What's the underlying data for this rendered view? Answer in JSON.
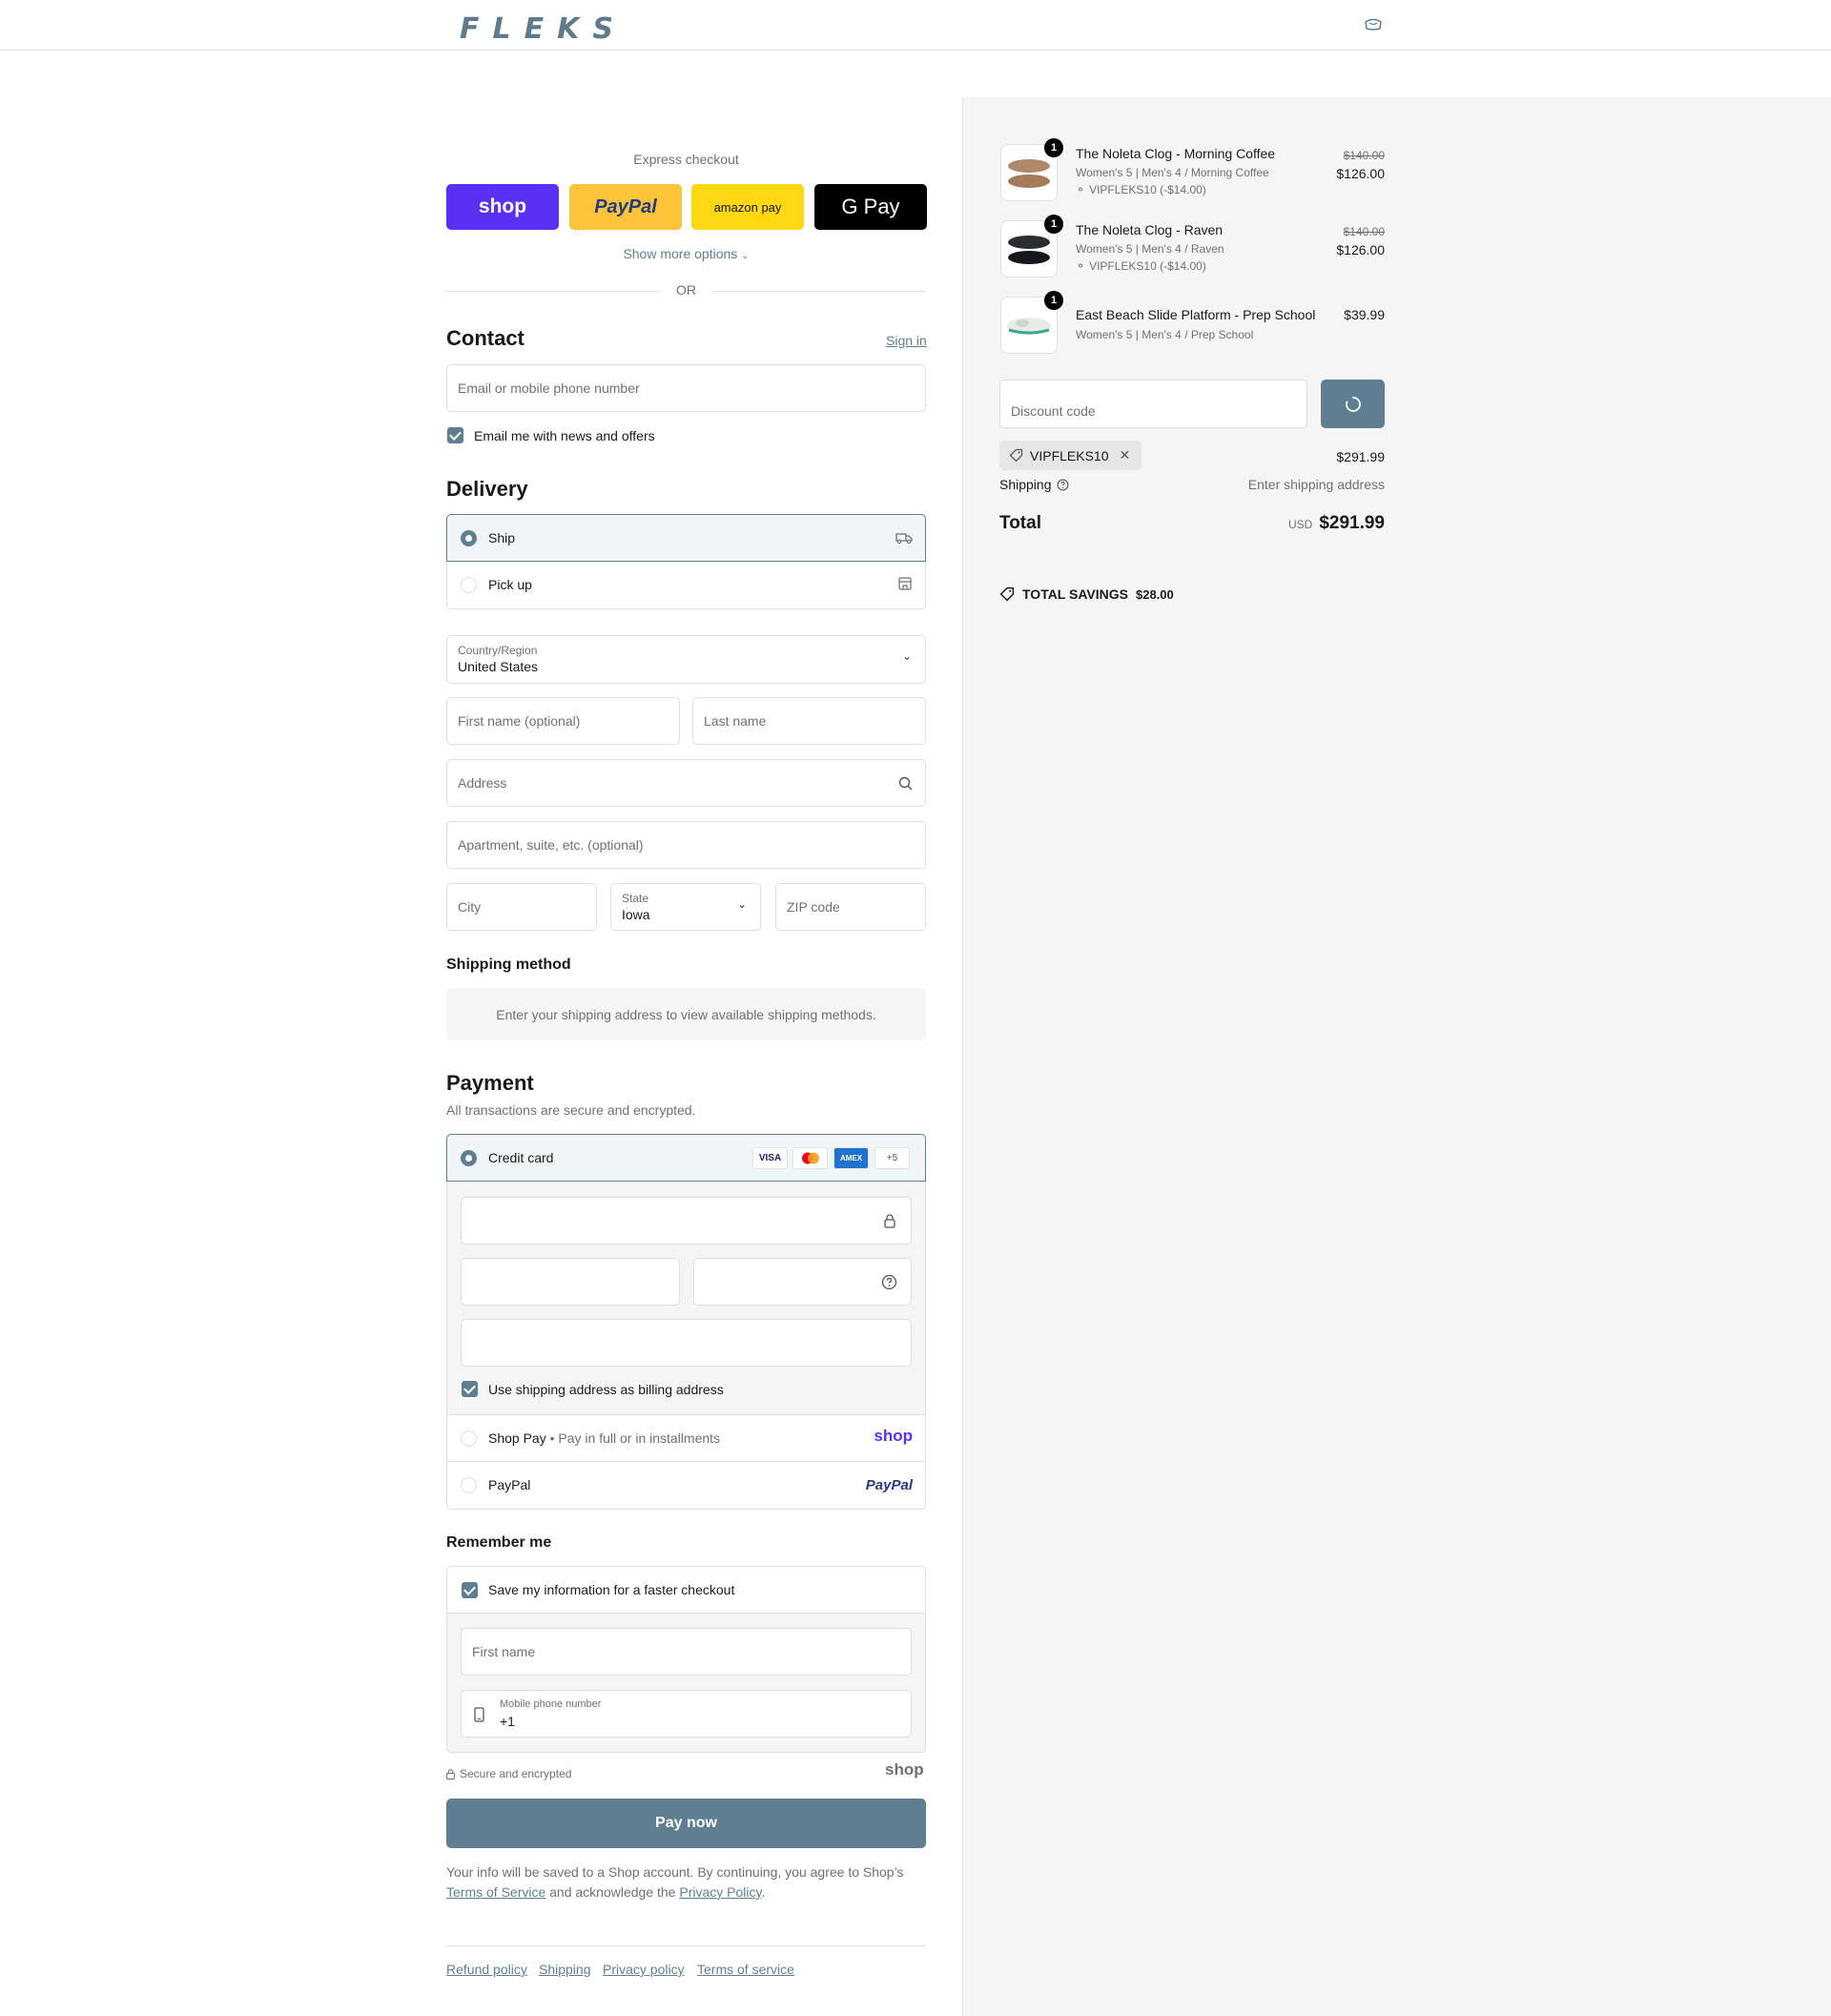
{
  "brand": {
    "logo_text": "FLEKS"
  },
  "express": {
    "label": "Express checkout",
    "buttons": [
      {
        "label": "shop",
        "color": "#5a31f4"
      },
      {
        "label": "PayPal",
        "color": "#ffc439"
      },
      {
        "label": "amazon pay",
        "color": "#ffd814"
      },
      {
        "label": "G Pay",
        "color": "#000000"
      }
    ],
    "more_options": "Show more options",
    "or": "OR"
  },
  "contact": {
    "title": "Contact",
    "sign_in": "Sign in",
    "email_placeholder": "Email or mobile phone number",
    "newsletter_label": "Email me with news and offers"
  },
  "delivery": {
    "title": "Delivery",
    "options": [
      {
        "label": "Ship",
        "selected": true
      },
      {
        "label": "Pick up",
        "selected": false
      }
    ],
    "country_label": "Country/Region",
    "country_value": "United States",
    "first_name_placeholder": "First name (optional)",
    "last_name_placeholder": "Last name",
    "address_placeholder": "Address",
    "apartment_placeholder": "Apartment, suite, etc. (optional)",
    "city_placeholder": "City",
    "state_label": "State",
    "state_value": "Iowa",
    "zip_placeholder": "ZIP code"
  },
  "shipping_method": {
    "title": "Shipping method",
    "notice": "Enter your shipping address to view available shipping methods."
  },
  "payment": {
    "title": "Payment",
    "subtitle": "All transactions are secure and encrypted.",
    "credit_card_label": "Credit card",
    "card_brands": [
      "VISA",
      "MC",
      "AMEX"
    ],
    "more_brands": "+5",
    "billing_same_label": "Use shipping address as billing address",
    "shop_pay_label": "Shop Pay",
    "shop_pay_sub": "Pay in full or in installments",
    "shop_pay_logo": "shop",
    "paypal_label": "PayPal",
    "paypal_logo": "PayPal"
  },
  "remember": {
    "title": "Remember me",
    "save_label": "Save my information for a faster checkout",
    "first_name_placeholder": "First name",
    "phone_label": "Mobile phone number",
    "phone_value": "+1",
    "secure_label": "Secure and encrypted",
    "shop_logo": "shop"
  },
  "pay_now": "Pay now",
  "legal": {
    "line1": "Your info will be saved to a Shop account. By continuing, you agree to Shop’s",
    "tos": "Terms of Service",
    "middle": "and acknowledge the",
    "privacy": "Privacy Policy",
    "end": "."
  },
  "footer_links": [
    "Refund policy",
    "Shipping",
    "Privacy policy",
    "Terms of service"
  ],
  "summary": {
    "items": [
      {
        "name": "The Noleta Clog - Morning Coffee",
        "variant": "Women's 5 | Men's 4 / Morning Coffee",
        "discount": "VIPFLEKS10 (-$14.00)",
        "original": "$140.00",
        "price": "$126.00",
        "qty": "1",
        "color": "#b08a68"
      },
      {
        "name": "The Noleta Clog - Raven",
        "variant": "Women's 5 | Men's 4 / Raven",
        "discount": "VIPFLEKS10 (-$14.00)",
        "original": "$140.00",
        "price": "$126.00",
        "qty": "1",
        "color": "#1f2226"
      },
      {
        "name": "East Beach Slide Platform - Prep School",
        "variant": "Women's 5 | Men's 4 / Prep School",
        "price": "$39.99",
        "qty": "1",
        "color": "#e8ece8"
      }
    ],
    "discount_placeholder": "Discount code",
    "applied_code": "VIPFLEKS10",
    "subtotal": "$291.99",
    "shipping_label": "Shipping",
    "shipping_value": "Enter shipping address",
    "total_label": "Total",
    "currency": "USD",
    "total": "$291.99",
    "savings_label": "TOTAL SAVINGS",
    "savings_value": "$28.00"
  }
}
